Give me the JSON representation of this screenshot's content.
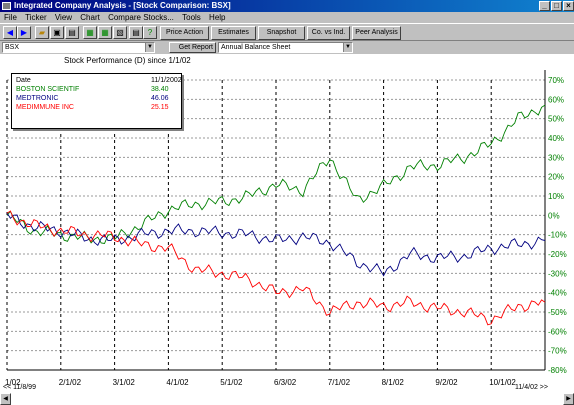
{
  "window": {
    "title": "Integrated Company Analysis - [Stock Comparison:  BSX]",
    "controls": [
      "_",
      "□",
      "×"
    ]
  },
  "menu": [
    "File",
    "Ticker",
    "View",
    "Chart",
    "Compare Stocks...",
    "Tools",
    "Help"
  ],
  "toolbar": {
    "icons": [
      "back-arrow-icon",
      "forward-arrow-icon",
      "open-folder-icon",
      "save-icon",
      "print-icon",
      "chart-icon",
      "table-icon",
      "copy-icon",
      "print-preview-icon",
      "help-icon"
    ],
    "buttons": [
      "Price Action",
      "Estimates",
      "Snapshot",
      "Co. vs Ind.",
      "Peer Analysis"
    ]
  },
  "row2": {
    "ticker_value": "BSX",
    "get_report_label": "Get Report",
    "report_select_value": "Annual Balance Sheet"
  },
  "chart": {
    "title": "Stock Performance (D)  since 1/1/02",
    "legend_header": {
      "label": "Date",
      "value": "11/1/2002"
    },
    "legend": [
      {
        "name": "BOSTON SCIENTIF",
        "value": "38.40",
        "color": "#008000"
      },
      {
        "name": "MEDTRONIC",
        "value": "46.06",
        "color": "#000080"
      },
      {
        "name": "MEDIMMUNE INC",
        "value": "25.15",
        "color": "#ff0000"
      }
    ]
  },
  "status": {
    "left": "<< 11/8/99",
    "right": "11/4/02 >>"
  },
  "chart_data": {
    "type": "line",
    "title": "Stock Performance (D)  since 1/1/02",
    "x_tick_labels": [
      "1/02",
      "2/1/02",
      "3/1/02",
      "4/1/02",
      "5/1/02",
      "6/3/02",
      "7/1/02",
      "8/1/02",
      "9/2/02",
      "10/1/02"
    ],
    "y_tick_labels": [
      "70%",
      "60%",
      "50%",
      "40%",
      "30%",
      "20%",
      "10%",
      "0%",
      "-10%",
      "-20%",
      "-30%",
      "-40%",
      "-50%",
      "-60%",
      "-70%",
      "-80%"
    ],
    "ylim": [
      -80,
      70
    ],
    "y_axis_side": "right",
    "grid": true,
    "legend_position": "top-left",
    "x_points": [
      "1/02",
      "1/15/02",
      "2/1/02",
      "2/15/02",
      "3/1/02",
      "3/15/02",
      "4/1/02",
      "4/15/02",
      "5/1/02",
      "5/15/02",
      "6/3/02",
      "6/15/02",
      "7/1/02",
      "7/15/02",
      "8/1/02",
      "8/15/02",
      "9/2/02",
      "9/15/02",
      "10/1/02",
      "10/15/02",
      "11/1/02"
    ],
    "series": [
      {
        "name": "BOSTON SCIENTIF",
        "color": "#008000",
        "values": [
          0,
          -8,
          -10,
          -12,
          -12,
          -5,
          3,
          6,
          7,
          10,
          16,
          13,
          30,
          8,
          15,
          25,
          26,
          30,
          37,
          50,
          57
        ]
      },
      {
        "name": "MEDTRONIC",
        "color": "#000080",
        "values": [
          0,
          -6,
          -8,
          -12,
          -13,
          -10,
          -8,
          -8,
          -9,
          -10,
          -13,
          -11,
          -14,
          -24,
          -30,
          -20,
          -22,
          -21,
          -17,
          -15,
          -13
        ]
      },
      {
        "name": "MEDIMMUNE INC",
        "color": "#ff0000",
        "values": [
          0,
          -5,
          -8,
          -10,
          -11,
          -15,
          -17,
          -28,
          -30,
          -33,
          -40,
          -38,
          -50,
          -45,
          -47,
          -45,
          -48,
          -50,
          -54,
          -47,
          -45
        ]
      }
    ]
  }
}
